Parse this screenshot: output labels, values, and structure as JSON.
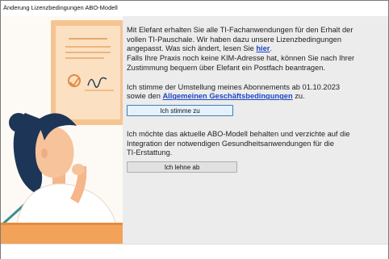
{
  "window": {
    "title": "Änderung Lizenzbedingungen ABO-Modell"
  },
  "illustration": {
    "description_icon": "woman-reading-certificate-illustration"
  },
  "intro": {
    "line1": "Mit Elefant erhalten Sie alle TI-Fachanwendungen für den Erhalt der",
    "line2": "vollen TI-Pauschale. Wir haben dazu unsere Lizenzbedingungen",
    "line3": "angepasst. Was sich ändert, lesen Sie ",
    "link_here": "hier",
    "line3_end": ".",
    "line4": "Falls Ihre Praxis noch keine KIM-Adresse hat, können Sie nach Ihrer",
    "line5": "Zustimmung bequem über Elefant ein Postfach beantragen."
  },
  "accept": {
    "line1": "Ich stimme der Umstellung meines Abonnements ab 01.10.2023",
    "line2_start": "sowie den ",
    "link_terms": "Allgemeinen Geschäftsbedingungen",
    "line2_end": " zu.",
    "button_label": "Ich stimme zu"
  },
  "decline": {
    "line1": "Ich möchte das aktuelle ABO-Modell behalten und verzichte auf die",
    "line2": "Integration der notwendigen Gesundheitsanwendungen für die",
    "line3": "TI-Erstattung.",
    "button_label": "Ich lehne ab"
  },
  "colors": {
    "link": "#1f45c4",
    "illustration_orange": "#f3a25a",
    "illustration_teal": "#3c8f93",
    "illustration_navy": "#1d3557"
  }
}
